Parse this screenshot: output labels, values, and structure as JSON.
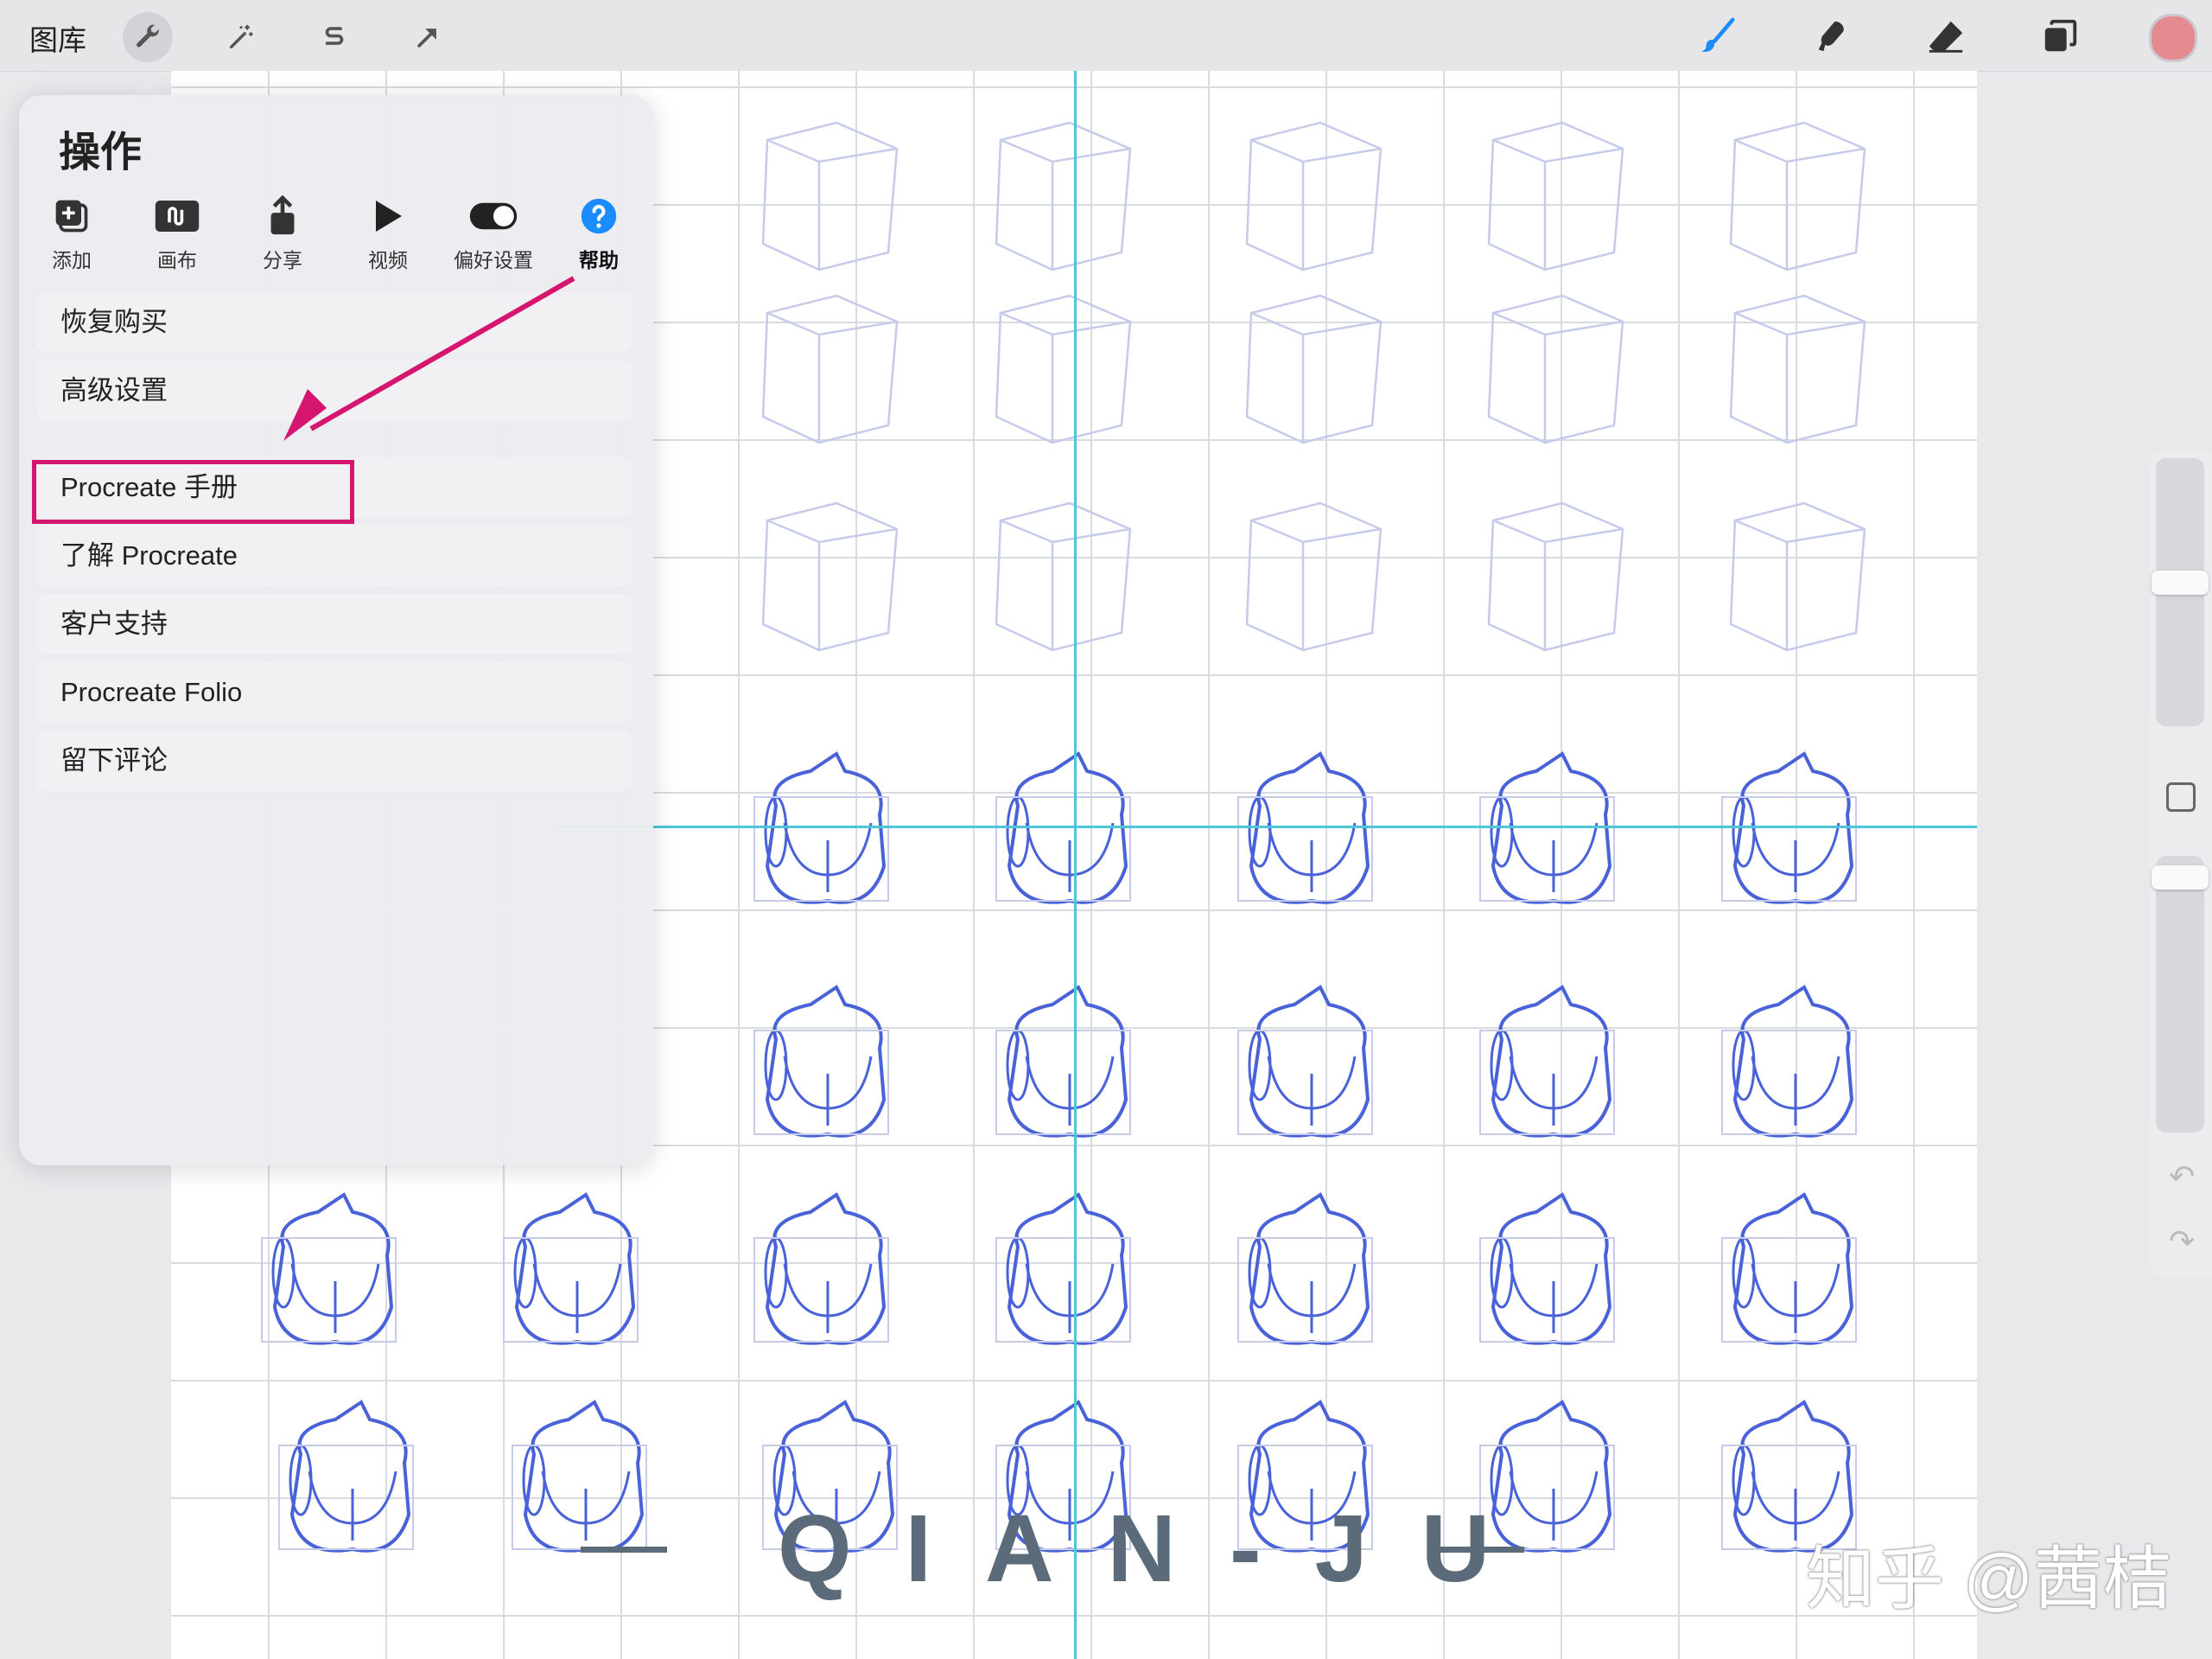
{
  "toolbar": {
    "gallery_label": "图库",
    "left_tools": [
      "wrench-icon",
      "magic-wand-icon",
      "selection-s-icon",
      "transform-arrow-icon"
    ],
    "right_tools": [
      "brush-icon",
      "smudge-icon",
      "eraser-icon",
      "layers-icon"
    ],
    "color": "#e48a90"
  },
  "actions_panel": {
    "title": "操作",
    "tabs": [
      {
        "label": "添加",
        "icon": "add-icon"
      },
      {
        "label": "画布",
        "icon": "canvas-icon"
      },
      {
        "label": "分享",
        "icon": "share-icon"
      },
      {
        "label": "视频",
        "icon": "video-play-icon"
      },
      {
        "label": "偏好设置",
        "icon": "toggle-icon"
      },
      {
        "label": "帮助",
        "icon": "help-icon"
      }
    ],
    "items": [
      "恢复购买",
      "高级设置",
      "Procreate 手册",
      "了解 Procreate",
      "客户支持",
      "Procreate Folio",
      "留下评论"
    ]
  },
  "watermark": {
    "text": "QIAN-JU",
    "credit": "知乎 @茜桔"
  },
  "colors": {
    "accent_pink": "#d5156f",
    "guide_cyan": "#4fc6d8",
    "help_blue": "#1a8cff",
    "sketch_blue": "#4a62d8"
  }
}
